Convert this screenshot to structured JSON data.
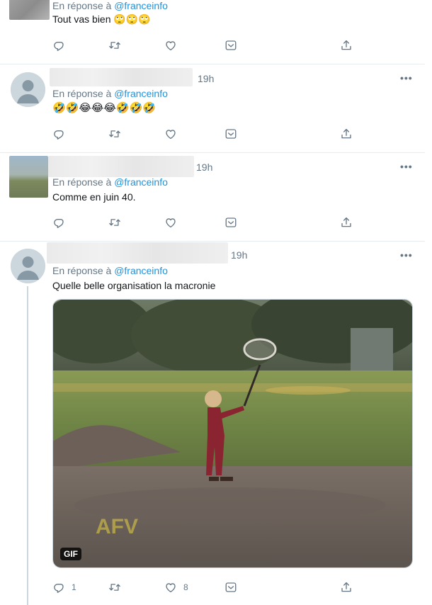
{
  "tweets": [
    {
      "reply_prefix": "En réponse à",
      "reply_handle": "@franceinfo",
      "text": "Tout  vas bien 🙄🙄🙄",
      "time": ""
    },
    {
      "reply_prefix": "En réponse à",
      "reply_handle": "@franceinfo",
      "text": "🤣🤣😂😂😂🤣🤣🤣",
      "time": "19h",
      "more": "•••"
    },
    {
      "reply_prefix": "En réponse à",
      "reply_handle": "@franceinfo",
      "text": "Comme en juin 40.",
      "time": "19h",
      "more": "•••"
    },
    {
      "reply_prefix": "En réponse à",
      "reply_handle": "@franceinfo",
      "text": "Quelle belle organisation la macronie",
      "time": "19h",
      "more": "•••",
      "media_badge": "GIF",
      "media_watermark": "AFV",
      "reply_count": "1",
      "like_count": "8"
    }
  ],
  "icons": [
    "reply-icon",
    "retweet-icon",
    "like-icon",
    "save-icon",
    "share-icon",
    "more-icon"
  ],
  "colors": {
    "link": "#1b95e0",
    "secondary": "#657786",
    "border": "#e6ecf0"
  }
}
